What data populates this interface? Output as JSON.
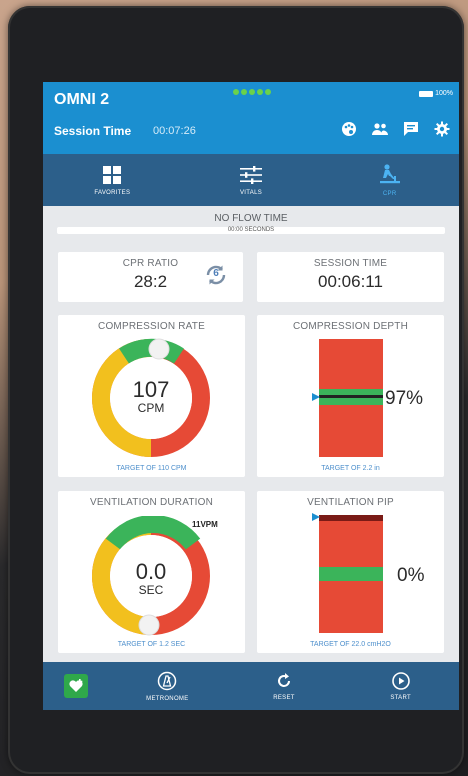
{
  "header": {
    "title": "OMNI 2",
    "battery": "100%",
    "session_label": "Session Time",
    "session_value": "00:07:26",
    "icons": [
      "palette-icon",
      "users-icon",
      "message-icon",
      "gear-icon"
    ]
  },
  "tabs": [
    {
      "label": "FAVORITES",
      "icon": "grid-icon"
    },
    {
      "label": "VITALS",
      "icon": "sliders-icon"
    },
    {
      "label": "CPR",
      "icon": "cpr-icon",
      "active": true
    }
  ],
  "no_flow": {
    "title": "NO FLOW TIME",
    "value": "00:00 SECONDS"
  },
  "cpr_ratio": {
    "title": "CPR RATIO",
    "value": "28:2",
    "badge": "6"
  },
  "session_time": {
    "title": "SESSION TIME",
    "value": "00:06:11"
  },
  "compression_rate": {
    "title": "COMPRESSION RATE",
    "value": "107",
    "unit": "CPM",
    "target": "TARGET OF 110 CPM"
  },
  "compression_depth": {
    "title": "COMPRESSION DEPTH",
    "value": "97%",
    "target": "TARGET OF 2.2 in",
    "level": 0.55
  },
  "ventilation_duration": {
    "title": "VENTILATION DURATION",
    "value": "0.0",
    "unit": "SEC",
    "rate": "11VPM",
    "target": "TARGET OF 1.2 SEC"
  },
  "ventilation_pip": {
    "title": "VENTILATION PIP",
    "value": "0%",
    "target": "TARGET OF 22.0 cmH2O"
  },
  "bottom": {
    "metronome": "METRONOME",
    "reset": "RESET",
    "start": "START"
  },
  "colors": {
    "accent": "#1b8fd0",
    "nav": "#2c5f8a",
    "red": "#e64a36",
    "green": "#3bb45a",
    "yellow": "#f2c01e"
  }
}
